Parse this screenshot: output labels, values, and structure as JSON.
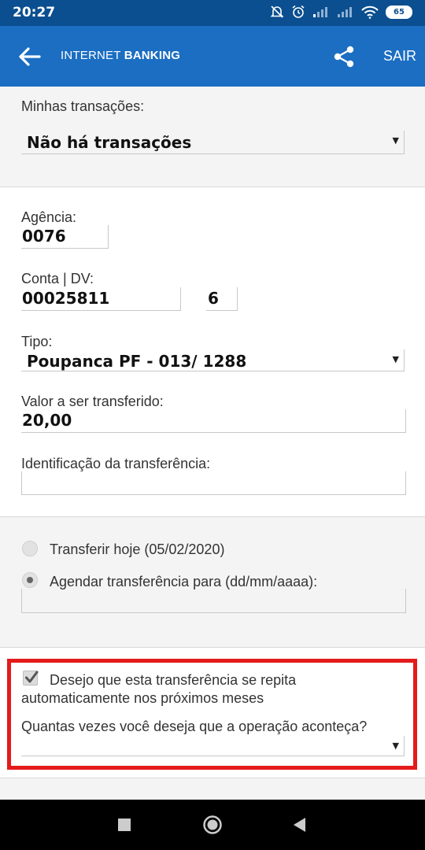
{
  "status_bar": {
    "time": "20:27",
    "battery": "65"
  },
  "app_bar": {
    "title_regular": "INTERNET ",
    "title_bold": "BANKING",
    "exit_label": "SAIR"
  },
  "transactions": {
    "label": "Minhas transações:",
    "selected": "Não há transações"
  },
  "form": {
    "agencia_label": "Agência:",
    "agencia_value": "0076",
    "conta_label": "Conta | DV:",
    "conta_value": "00025811",
    "dv_value": "6",
    "tipo_label": "Tipo:",
    "tipo_value": "Poupanca PF - 013/ 1288",
    "valor_label": "Valor a ser transferido:",
    "valor_value": "20,00",
    "identificacao_label": "Identificação da transferência:",
    "identificacao_value": ""
  },
  "schedule": {
    "today_label": "Transferir hoje (05/02/2020)",
    "schedule_label": "Agendar transferência para (dd/mm/aaaa):",
    "schedule_value": "",
    "selected_option": "schedule"
  },
  "repeat": {
    "checked": true,
    "checkbox_label_line1": "Desejo que esta transferência se repita",
    "checkbox_label_line2": "automaticamente nos próximos meses",
    "times_label": "Quantas vezes você deseja que a operação aconteça?",
    "times_value": ""
  },
  "colors": {
    "status_bar": "#0b4f90",
    "app_bar": "#1b6ec2",
    "highlight": "#e41b1b"
  },
  "icons": {
    "back": "arrow-left-icon",
    "share": "share-icon",
    "nav_recent": "square-icon",
    "nav_home": "circle-icon",
    "nav_back": "triangle-back-icon"
  }
}
